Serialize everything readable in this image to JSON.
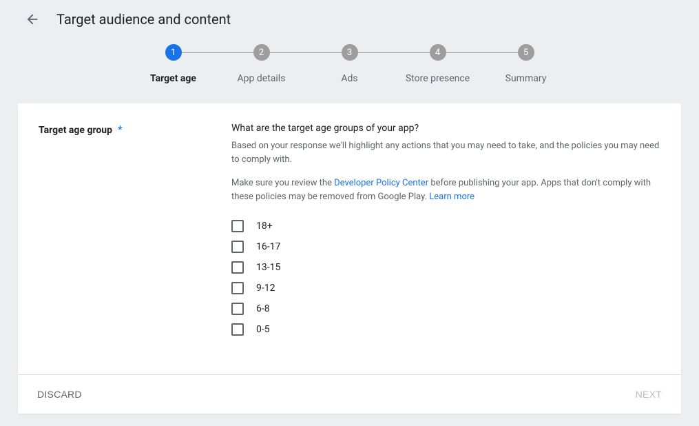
{
  "header": {
    "title": "Target audience and content"
  },
  "stepper": {
    "steps": [
      {
        "num": "1",
        "label": "Target age",
        "active": true
      },
      {
        "num": "2",
        "label": "App details",
        "active": false
      },
      {
        "num": "3",
        "label": "Ads",
        "active": false
      },
      {
        "num": "4",
        "label": "Store presence",
        "active": false
      },
      {
        "num": "5",
        "label": "Summary",
        "active": false
      }
    ]
  },
  "form": {
    "field_label": "Target age group",
    "required_mark": "*",
    "question": "What are the target age groups of your app?",
    "hint1": "Based on your response we'll highlight any actions that you may need to take, and the policies you may need to comply with.",
    "hint2_pre": "Make sure you review the ",
    "hint2_link1": "Developer Policy Center",
    "hint2_mid": " before publishing your app. Apps that don't comply with these policies may be removed from Google Play. ",
    "hint2_link2": "Learn more",
    "options": [
      {
        "label": "18+"
      },
      {
        "label": "16-17"
      },
      {
        "label": "13-15"
      },
      {
        "label": "9-12"
      },
      {
        "label": "6-8"
      },
      {
        "label": "0-5"
      }
    ]
  },
  "footer": {
    "discard": "Discard",
    "next": "Next"
  }
}
